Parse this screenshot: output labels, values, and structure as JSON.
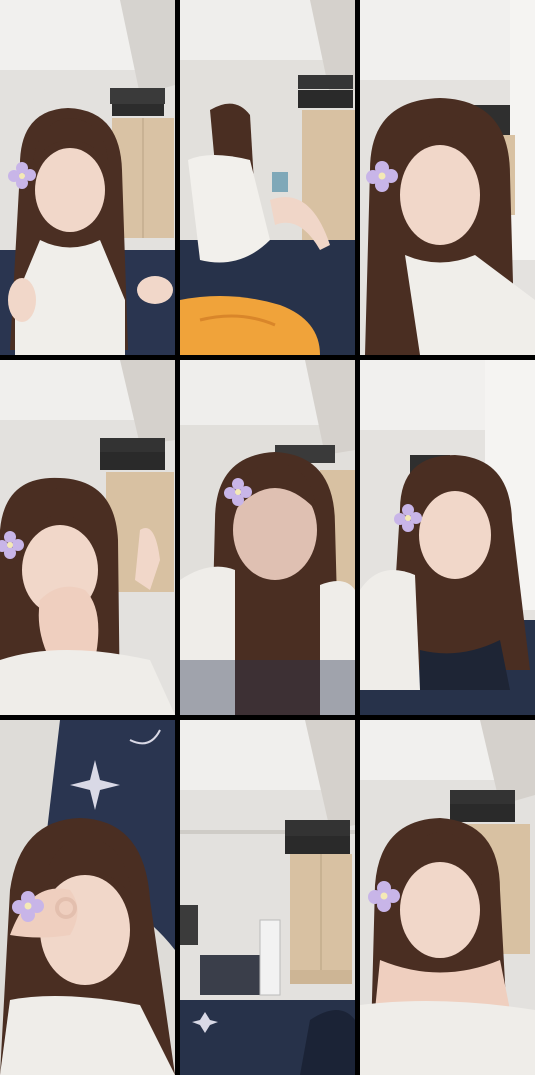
{
  "grid": {
    "rows": 3,
    "columns": 3,
    "background_color": "#000000"
  },
  "tiles": [
    {
      "scene": "girl-facing-camera-with-flower-hair-clip"
    },
    {
      "scene": "girl-sitting-on-bed-with-orange-towel"
    },
    {
      "scene": "girl-close-up-with-flower-hair-clip"
    },
    {
      "scene": "girl-lying-with-hands-near-mouth"
    },
    {
      "scene": "girl-blurred-face-with-flower-hair-clip"
    },
    {
      "scene": "girl-lying-on-bed-looking-at-camera"
    },
    {
      "scene": "girl-making-ok-gesture-over-eye"
    },
    {
      "scene": "empty-room-with-bed-and-cabinet"
    },
    {
      "scene": "girl-resting-chin-on-hands"
    }
  ],
  "colors": {
    "wall": "#e4e2df",
    "ceiling": "#f2f1ef",
    "cabinet": "#d8c1a2",
    "hair": "#4a2e22",
    "skin": "#f0d6c8",
    "shirt": "#f1efec",
    "bedding": "#27324a",
    "towel": "#f0a33a",
    "flower": "#c9b6e8"
  }
}
